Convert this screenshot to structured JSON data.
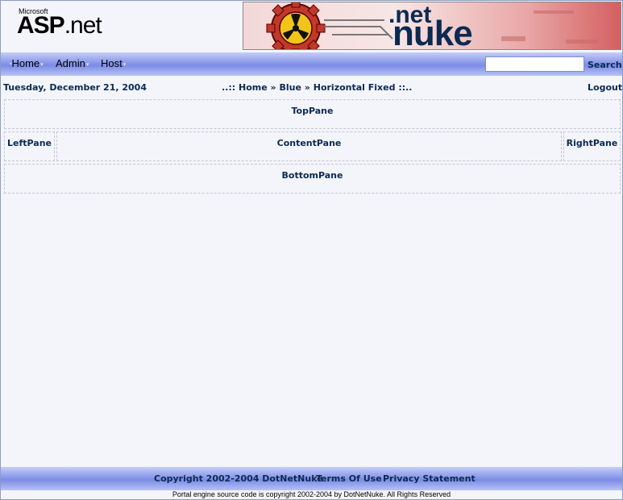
{
  "header": {
    "aspnet_logo": {
      "small_text": "Microsoft",
      "main_bold": "ASP",
      "main_tail": ".net"
    },
    "banner": {
      "dot": ".net",
      "word": "nuke"
    }
  },
  "nav": {
    "menu": [
      "Home",
      "Admin",
      "Host"
    ],
    "search": {
      "value": "",
      "button_label": "Search"
    }
  },
  "info_bar": {
    "date": "Tuesday, December 21, 2004",
    "breadcrumb_prefix": "..::",
    "breadcrumb": [
      "Home",
      "Blue",
      "Horizontal Fixed"
    ],
    "breadcrumb_separator": "»",
    "breadcrumb_suffix": "::..",
    "logout_label": "Logout"
  },
  "panes": {
    "top": "TopPane",
    "left": "LeftPane",
    "content": "ContentPane",
    "right": "RightPane",
    "bottom": "BottomPane"
  },
  "footer": {
    "copyright": "Copyright 2002-2004 DotNetNuke",
    "terms": "Terms Of Use",
    "privacy": "Privacy Statement",
    "engine_note": "Portal engine source code is copyright 2002-2004 by DotNetNuke. All Rights Reserved"
  },
  "colors": {
    "link": "#0a2a52",
    "nav_gradient_mid": "#7c8be5",
    "background": "#f4f5fa"
  }
}
